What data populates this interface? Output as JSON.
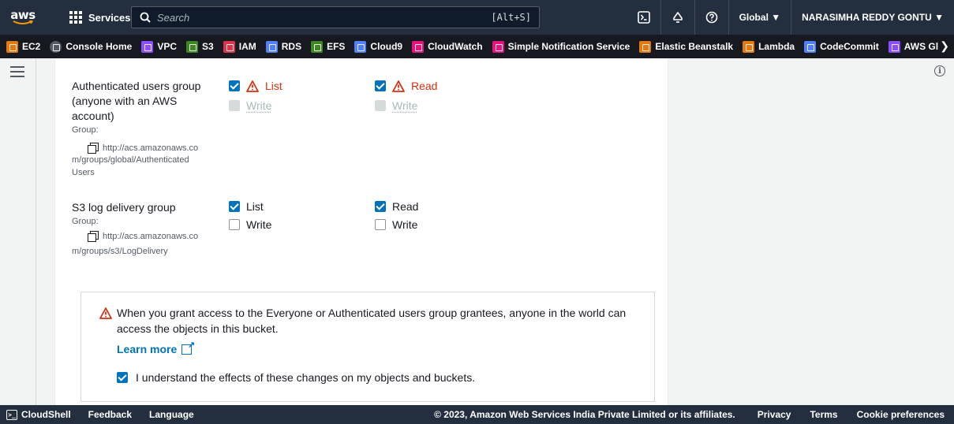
{
  "topnav": {
    "logo": "aws",
    "services_label": "Services",
    "search_placeholder": "Search",
    "search_shortcut": "[Alt+S]",
    "region": "Global ▼",
    "account": "NARASIMHA REDDY GONTU ▼",
    "icons": [
      "cloudshell-icon",
      "bell-icon",
      "help-icon"
    ]
  },
  "favorites": [
    {
      "label": "EC2",
      "color": "#e47911"
    },
    {
      "label": "Console Home",
      "color": "#545b64"
    },
    {
      "label": "VPC",
      "color": "#8c4fff"
    },
    {
      "label": "S3",
      "color": "#3f8624"
    },
    {
      "label": "IAM",
      "color": "#dd344c"
    },
    {
      "label": "RDS",
      "color": "#527fff"
    },
    {
      "label": "EFS",
      "color": "#3f8624"
    },
    {
      "label": "Cloud9",
      "color": "#527fff"
    },
    {
      "label": "CloudWatch",
      "color": "#e7157b"
    },
    {
      "label": "Simple Notification Service",
      "color": "#e7157b"
    },
    {
      "label": "Elastic Beanstalk",
      "color": "#e47911"
    },
    {
      "label": "Lambda",
      "color": "#e47911"
    },
    {
      "label": "CodeCommit",
      "color": "#527fff"
    },
    {
      "label": "AWS Gl",
      "color": "#8c4fff"
    }
  ],
  "grantees": {
    "authenticated": {
      "name": "Authenticated users group (anyone with an AWS account)",
      "group_label": "Group:",
      "uri_line1": "http://acs.amazonaws.co",
      "uri_rest": "m/groups/global/Authenticated Users",
      "objects_list": "List",
      "objects_write": "Write",
      "acl_read": "Read",
      "acl_write": "Write"
    },
    "logdelivery": {
      "name": "S3 log delivery group",
      "group_label": "Group:",
      "uri_line1": "http://acs.amazonaws.co",
      "uri_rest": "m/groups/s3/LogDelivery",
      "objects_list": "List",
      "objects_write": "Write",
      "acl_read": "Read",
      "acl_write": "Write"
    }
  },
  "alert": {
    "message": "When you grant access to the Everyone or Authenticated users group grantees, anyone in the world can access the objects in this bucket.",
    "learn_more": "Learn more",
    "acknowledge": "I understand the effects of these changes on my objects and buckets."
  },
  "footer": {
    "cloudshell": "CloudShell",
    "feedback": "Feedback",
    "language": "Language",
    "copyright": "© 2023, Amazon Web Services India Private Limited or its affiliates.",
    "privacy": "Privacy",
    "terms": "Terms",
    "cookies": "Cookie preferences"
  },
  "colors": {
    "nav": "#232f3e",
    "accent": "#0073bb",
    "warning": "#d13212"
  }
}
